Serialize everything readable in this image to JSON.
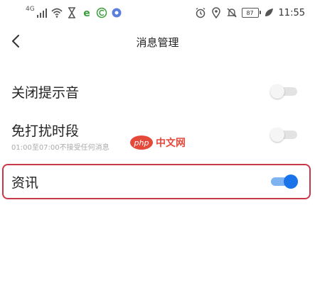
{
  "status_bar": {
    "network_label": "4G",
    "battery": "87",
    "time": "11:55"
  },
  "header": {
    "title": "消息管理"
  },
  "settings": [
    {
      "label": "关闭提示音",
      "enabled": false
    },
    {
      "label": "免打扰时段",
      "sublabel": "01:00至07:00不接受任何消息",
      "enabled": false
    },
    {
      "label": "资讯",
      "enabled": true
    }
  ],
  "watermark": {
    "logo": "php",
    "text": "中文网"
  },
  "colors": {
    "accent": "#1a73e8",
    "highlight": "#c8384a",
    "watermark": "#e5493a"
  }
}
